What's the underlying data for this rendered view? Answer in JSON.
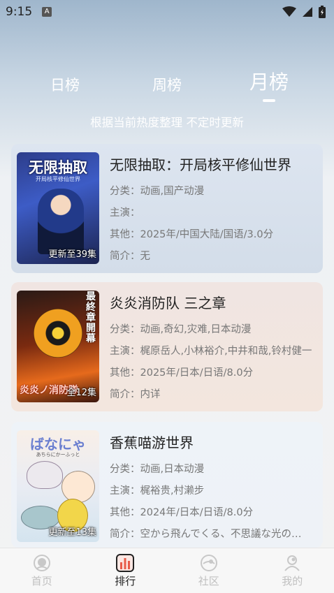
{
  "status_bar": {
    "time": "9:15",
    "notification_icon": "A"
  },
  "tabs": [
    {
      "label": "日榜",
      "active": false
    },
    {
      "label": "周榜",
      "active": false
    },
    {
      "label": "月榜",
      "active": true
    }
  ],
  "subtitle": "根据当前热度整理 不定时更新",
  "cards": [
    {
      "poster_title": "无限抽取",
      "poster_subtitle": "开局核平修仙世界",
      "badge": "更新至39集",
      "title": "无限抽取：开局核平修仙世界",
      "category": "分类：动画,国产动漫",
      "cast": "主演：",
      "other": "其他：2025年/中国大陆/国语/3.0分",
      "intro": "简介：无"
    },
    {
      "poster_vertical": "最終章開幕",
      "poster_logo": "炎炎ノ消防隊",
      "badge": "全12集",
      "title": "炎炎消防队 三之章",
      "category": "分类：动画,奇幻,灾难,日本动漫",
      "cast": "主演：梶原岳人,小林裕介,中井和哉,铃村健一",
      "other": "其他：2025年/日本/日语/8.0分",
      "intro": "简介：内详"
    },
    {
      "poster_title": "ばなにゃ",
      "poster_subtitle": "あちらにかーふっと",
      "badge": "更新至13集",
      "title": "香蕉喵游世界",
      "category": "分类：动画,日本动漫",
      "cast": "主演：梶裕贵,村濑步",
      "other": "其他：2024年/日本/日语/8.0分",
      "intro": "简介：空から飛んでくる、不思議な光の…"
    }
  ],
  "nav": [
    {
      "label": "首页",
      "icon": "home-icon",
      "active": false
    },
    {
      "label": "排行",
      "icon": "ranking-icon",
      "active": true
    },
    {
      "label": "社区",
      "icon": "community-icon",
      "active": false
    },
    {
      "label": "我的",
      "icon": "profile-icon",
      "active": false
    }
  ],
  "colors": {
    "active_nav": "#222222",
    "inactive_nav": "#c0c0c0",
    "ranking_icon": "#e85c4a"
  }
}
